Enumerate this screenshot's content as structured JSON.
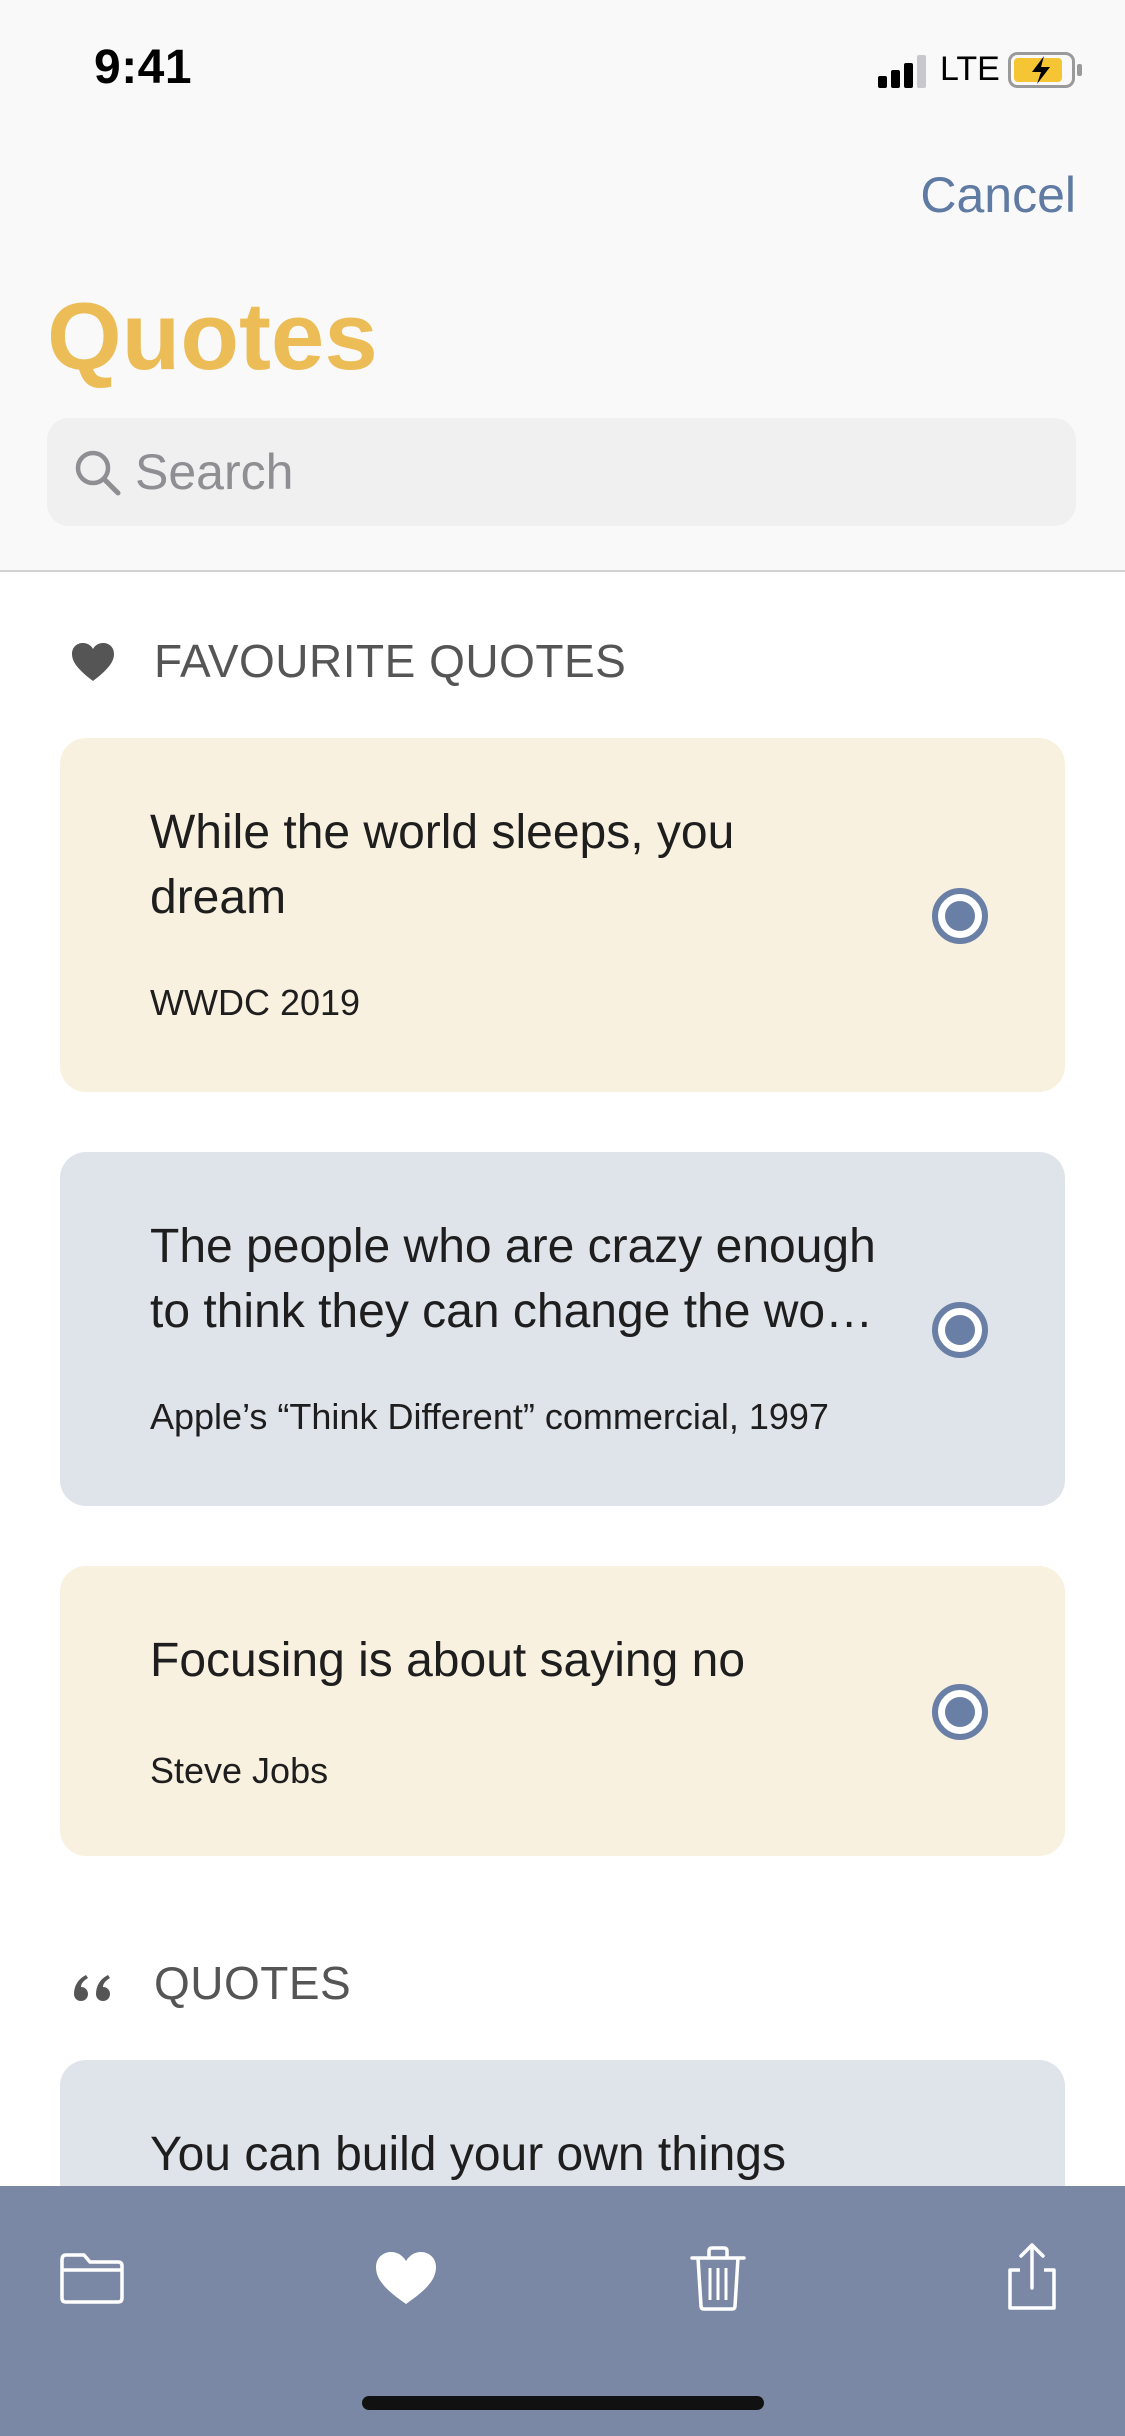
{
  "status_bar": {
    "time": "9:41",
    "network": "LTE",
    "battery_color": "#f5c533"
  },
  "header": {
    "cancel_label": "Cancel",
    "title": "Quotes",
    "title_color": "#ecbd57"
  },
  "search": {
    "placeholder": "Search",
    "value": ""
  },
  "sections": {
    "favourites": {
      "icon": "heart-icon",
      "title": "FAVOURITE QUOTES",
      "cards": [
        {
          "text": "While the world sleeps, you\ndream",
          "source": "WWDC 2019",
          "color": "#f9f1e0"
        },
        {
          "text": "The people who are crazy enough\nto think they can change the wo…",
          "source": "Apple’s “Think Different” commercial, 1997",
          "color": "#dfe3ea"
        },
        {
          "text": "Focusing is about saying no",
          "source": "Steve Jobs",
          "color": "#f9f1e0"
        }
      ]
    },
    "quotes": {
      "icon": "quote-marks-icon",
      "title": "QUOTES",
      "cards": [
        {
          "text": "You can build your own things",
          "color": "#dfe3ea"
        }
      ]
    }
  },
  "toolbar": {
    "background": "#7a88a6",
    "items": [
      {
        "icon": "folder-icon"
      },
      {
        "icon": "heart-icon"
      },
      {
        "icon": "trash-icon"
      },
      {
        "icon": "share-icon"
      }
    ]
  },
  "accent_color": "#5f7aa3"
}
